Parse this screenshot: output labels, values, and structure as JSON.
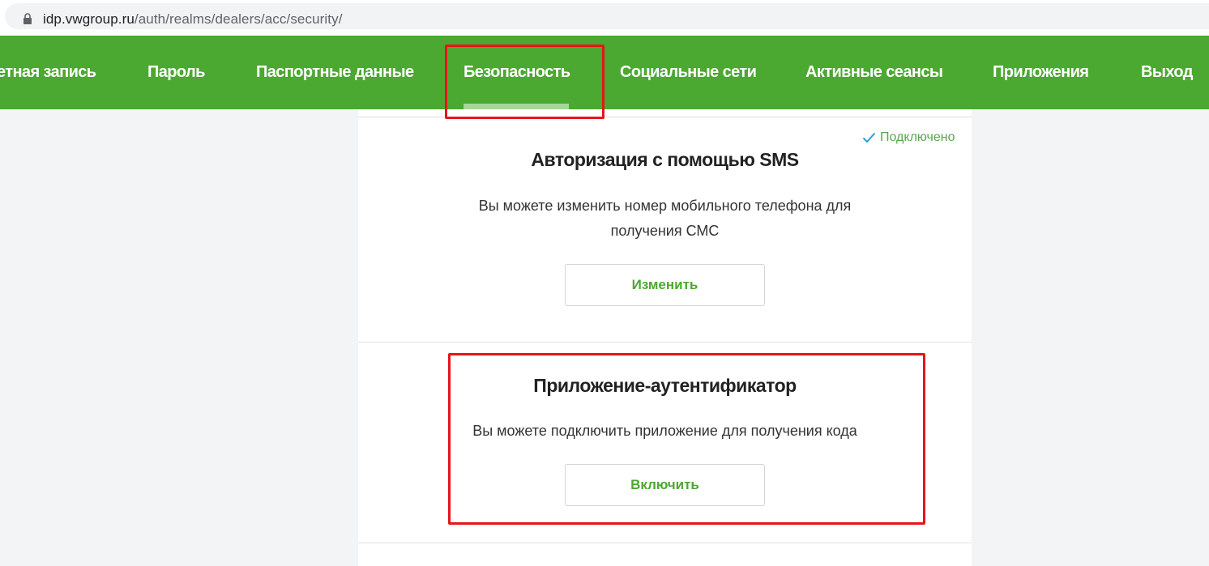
{
  "browser": {
    "url_domain": "idp.vwgroup.ru",
    "url_path": "/auth/realms/dealers/acc/security/"
  },
  "nav": {
    "items": [
      {
        "label": "етная запись"
      },
      {
        "label": "Пароль"
      },
      {
        "label": "Паспортные данные"
      },
      {
        "label": "Безопасность",
        "active": true
      },
      {
        "label": "Социальные сети"
      },
      {
        "label": "Активные сеансы"
      },
      {
        "label": "Приложения"
      },
      {
        "label": "Выход"
      }
    ]
  },
  "sms_card": {
    "status": "Подключено",
    "title": "Авторизация с помощью SMS",
    "description_line1": "Вы можете изменить номер мобильного телефона для",
    "description_line2": "получения СМС",
    "button_label": "Изменить"
  },
  "auth_app_card": {
    "title": "Приложение-аутентификатор",
    "description": "Вы можете подключить приложение для получения кода",
    "button_label": "Включить"
  },
  "colors": {
    "brand_green": "#4ba830",
    "active_underline": "#a5d896",
    "annotation_red": "#e8141a",
    "status_green": "#56a84b",
    "check_blue": "#2a9fd6"
  },
  "icons": {
    "lock": "lock-icon",
    "check": "checkmark-icon"
  }
}
